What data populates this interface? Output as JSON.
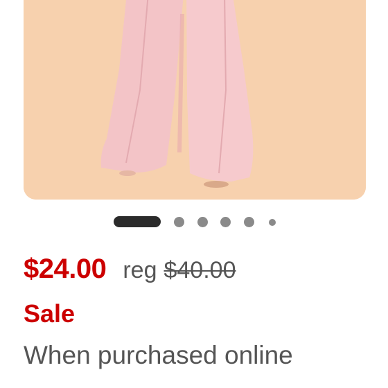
{
  "product": {
    "image_alt": "Pink wide-leg trousers",
    "carousel": {
      "total": 6,
      "active_index": 0
    }
  },
  "pricing": {
    "sale_price": "$24.00",
    "reg_label": "reg",
    "reg_price": "$40.00",
    "sale_badge": "Sale",
    "purchase_note": "When purchased online"
  },
  "colors": {
    "sale_red": "#cc0000",
    "text_gray": "#555555",
    "image_background": "#f7d1ae",
    "trouser_pink": "#f3c4c7"
  },
  "icons": [
    "carousel-dot-active",
    "carousel-dot"
  ]
}
